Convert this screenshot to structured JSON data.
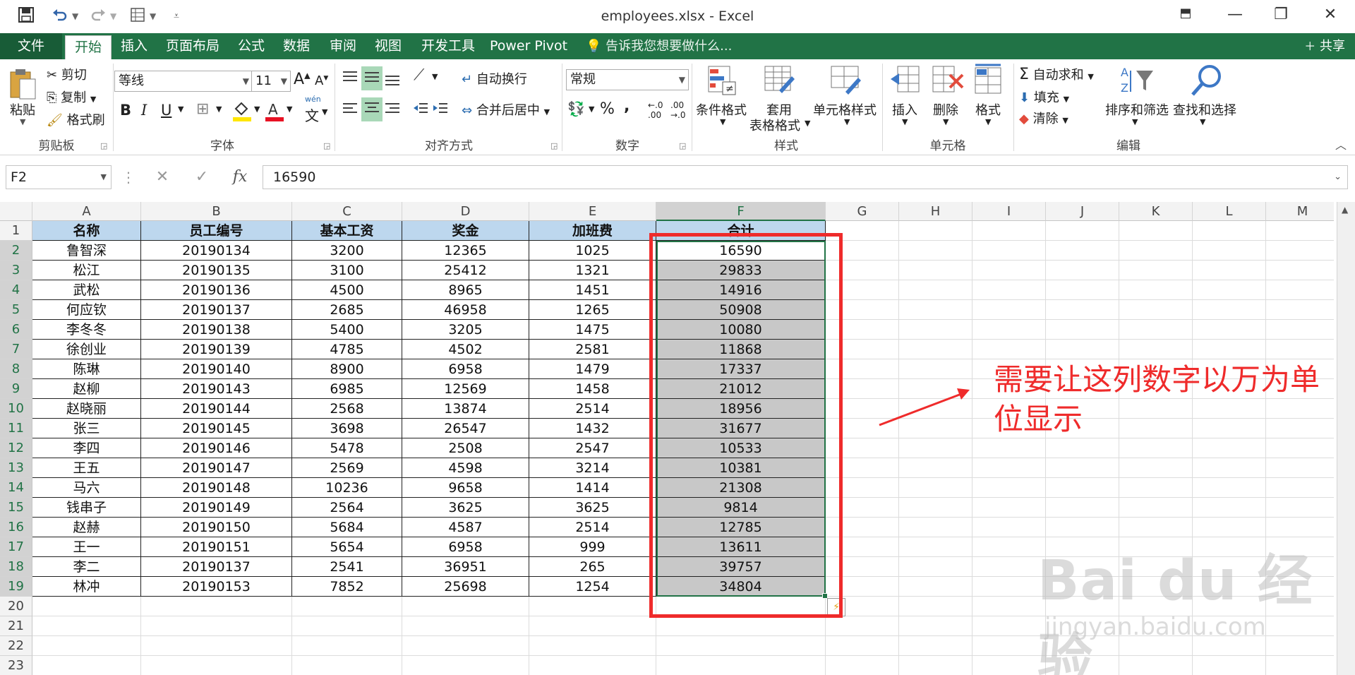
{
  "window": {
    "title": "employees.xlsx - Excel"
  },
  "tabs": [
    {
      "label": "文件"
    },
    {
      "label": "开始"
    },
    {
      "label": "插入"
    },
    {
      "label": "页面布局"
    },
    {
      "label": "公式"
    },
    {
      "label": "数据"
    },
    {
      "label": "审阅"
    },
    {
      "label": "视图"
    },
    {
      "label": "开发工具"
    },
    {
      "label": "Power Pivot"
    }
  ],
  "tellme": "告诉我您想要做什么...",
  "share": "共享",
  "clipboard": {
    "paste": "粘贴",
    "cut": "剪切",
    "copy": "复制",
    "format_painter": "格式刷",
    "group": "剪贴板"
  },
  "font": {
    "name": "等线",
    "size": "11",
    "grow": "A",
    "shrink": "A",
    "bold": "B",
    "italic": "I",
    "underline": "U",
    "phonetic_top": "wén",
    "phonetic": "文",
    "group": "字体",
    "color_fill": "#ffe600",
    "color_font": "#e81123"
  },
  "alignment": {
    "wrap": "自动换行",
    "merge": "合并后居中",
    "group": "对齐方式"
  },
  "number": {
    "format": "常规",
    "percent": "%",
    "comma": ",",
    "group": "数字"
  },
  "styles": {
    "cond": "条件格式",
    "table": "套用",
    "table2": "表格格式",
    "cell": "单元格样式",
    "group": "样式"
  },
  "cells": {
    "insert": "插入",
    "delete": "删除",
    "format": "格式",
    "group": "单元格"
  },
  "editing": {
    "autosum": "自动求和",
    "fill": "填充",
    "clear": "清除",
    "sort": "排序和筛选",
    "find": "查找和选择",
    "group": "编辑"
  },
  "formula": {
    "namebox": "F2",
    "fx": "fx",
    "value": "16590"
  },
  "columns": [
    "A",
    "B",
    "C",
    "D",
    "E",
    "F",
    "G",
    "H",
    "I",
    "J",
    "K",
    "L",
    "M"
  ],
  "rows": [
    "1",
    "2",
    "3",
    "4",
    "5",
    "6",
    "7",
    "8",
    "9",
    "10",
    "11",
    "12",
    "13",
    "14",
    "15",
    "16",
    "17",
    "18",
    "19",
    "20",
    "21",
    "22",
    "23"
  ],
  "table": {
    "headers": [
      "名称",
      "员工编号",
      "基本工资",
      "奖金",
      "加班费",
      "合计"
    ],
    "rows": [
      [
        "鲁智深",
        "20190134",
        "3200",
        "12365",
        "1025",
        "16590"
      ],
      [
        "松江",
        "20190135",
        "3100",
        "25412",
        "1321",
        "29833"
      ],
      [
        "武松",
        "20190136",
        "4500",
        "8965",
        "1451",
        "14916"
      ],
      [
        "何应钦",
        "20190137",
        "2685",
        "46958",
        "1265",
        "50908"
      ],
      [
        "李冬冬",
        "20190138",
        "5400",
        "3205",
        "1475",
        "10080"
      ],
      [
        "徐创业",
        "20190139",
        "4785",
        "4502",
        "2581",
        "11868"
      ],
      [
        "陈琳",
        "20190140",
        "8900",
        "6958",
        "1479",
        "17337"
      ],
      [
        "赵柳",
        "20190143",
        "6985",
        "12569",
        "1458",
        "21012"
      ],
      [
        "赵晓丽",
        "20190144",
        "2568",
        "13874",
        "2514",
        "18956"
      ],
      [
        "张三",
        "20190145",
        "3698",
        "26547",
        "1432",
        "31677"
      ],
      [
        "李四",
        "20190146",
        "5478",
        "2508",
        "2547",
        "10533"
      ],
      [
        "王五",
        "20190147",
        "2569",
        "4598",
        "3214",
        "10381"
      ],
      [
        "马六",
        "20190148",
        "10236",
        "9658",
        "1414",
        "21308"
      ],
      [
        "钱串子",
        "20190149",
        "2564",
        "3625",
        "3625",
        "9814"
      ],
      [
        "赵赫",
        "20190150",
        "5684",
        "4587",
        "2514",
        "12785"
      ],
      [
        "王一",
        "20190151",
        "5654",
        "6958",
        "999",
        "13611"
      ],
      [
        "李二",
        "20190137",
        "2541",
        "36951",
        "265",
        "39757"
      ],
      [
        "林冲",
        "20190153",
        "7852",
        "25698",
        "1254",
        "34804"
      ]
    ]
  },
  "annotation": "需要让这列数字以万为单位显示",
  "watermark": {
    "line1": "Bai du 经验",
    "line2": "jingyan.baidu.com"
  },
  "colors": {
    "excel_green": "#217346",
    "header_fill": "#bdd7ee",
    "highlight_red": "#ef2b2b",
    "selection_gray": "#c8c8c8"
  }
}
